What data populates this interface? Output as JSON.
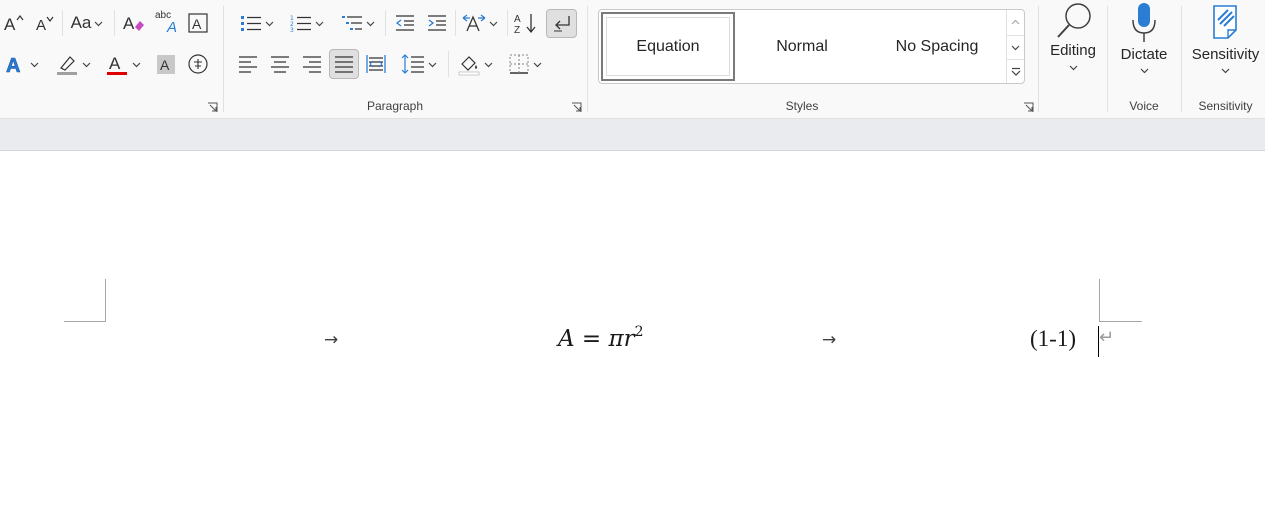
{
  "ribbon": {
    "groups": {
      "paragraph_label": "Paragraph",
      "styles_label": "Styles",
      "voice_label": "Voice",
      "sensitivity_label": "Sensitivity"
    },
    "font": {
      "change_case_label": "Aa",
      "font_color": "#e00000",
      "highlight_color": "#a0a0a0"
    },
    "styles_gallery": {
      "items": [
        "Equation",
        "Normal",
        "No Spacing"
      ],
      "selected": "Equation"
    },
    "editing_label": "Editing",
    "dictate_label": "Dictate",
    "sensitivity_button_label": "Sensitivity"
  },
  "document": {
    "tab_arrow_1": "→",
    "tab_arrow_2": "→",
    "equation": {
      "var_a": "A",
      "equals": " = ",
      "pi": "π",
      "var_r": "r",
      "exponent": "2"
    },
    "equation_number": "(1-1)",
    "paragraph_mark": "↵"
  },
  "colors": {
    "accent_blue": "#2b7cd3",
    "font_color_red": "#e00000"
  }
}
